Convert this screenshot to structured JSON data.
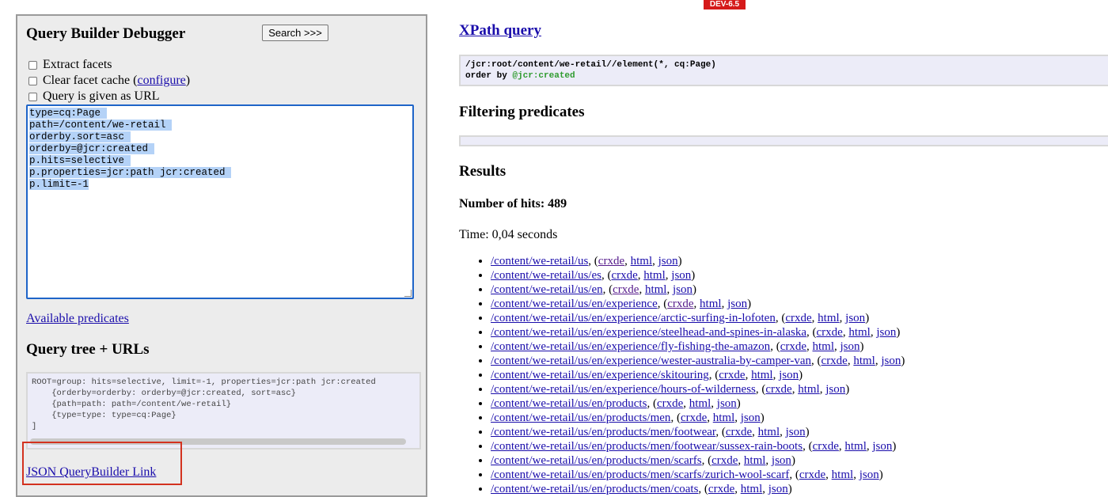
{
  "env_badge": "DEV-6.5",
  "left_panel": {
    "title": "Query Builder Debugger",
    "search_button": "Search >>>",
    "checkboxes": {
      "extract_facets": "Extract facets",
      "clear_cache": "Clear facet cache (",
      "configure_link": "configure",
      "clear_cache_close": ")",
      "query_as_url": "Query is given as URL"
    },
    "query_lines": [
      "type=cq:Page",
      "path=/content/we-retail",
      "orderby.sort=asc",
      "orderby=@jcr:created",
      "p.hits=selective",
      "p.properties=jcr:path jcr:created",
      "p.limit=-1"
    ],
    "available_predicates_link": "Available predicates",
    "tree_title": "Query tree + URLs",
    "tree_lines": [
      "ROOT=group: hits=selective, limit=-1, properties=jcr:path jcr:created",
      "    {orderby=orderby: orderby=@jcr:created, sort=asc}",
      "    {path=path: path=/content/we-retail}",
      "    {type=type: type=cq:Page}",
      "]"
    ],
    "json_link": "JSON QueryBuilder Link"
  },
  "right_panel": {
    "xpath_link": "XPath query",
    "xpath_line1": "/jcr:root/content/we-retail//element(*, cq:Page)",
    "xpath_line2_prefix": "order by ",
    "xpath_line2_attr": "@jcr:created",
    "filter_title": "Filtering predicates",
    "results_title": "Results",
    "hits_label": "Number of hits: 489",
    "time_label": "Time: 0,04 seconds",
    "link_crxde": "crxde",
    "link_html": "html",
    "link_json": "json",
    "results": [
      "/content/we-retail/us",
      "/content/we-retail/us/es",
      "/content/we-retail/us/en",
      "/content/we-retail/us/en/experience",
      "/content/we-retail/us/en/experience/arctic-surfing-in-lofoten",
      "/content/we-retail/us/en/experience/steelhead-and-spines-in-alaska",
      "/content/we-retail/us/en/experience/fly-fishing-the-amazon",
      "/content/we-retail/us/en/experience/wester-australia-by-camper-van",
      "/content/we-retail/us/en/experience/skitouring",
      "/content/we-retail/us/en/experience/hours-of-wilderness",
      "/content/we-retail/us/en/products",
      "/content/we-retail/us/en/products/men",
      "/content/we-retail/us/en/products/men/footwear",
      "/content/we-retail/us/en/products/men/footwear/sussex-rain-boots",
      "/content/we-retail/us/en/products/men/scarfs",
      "/content/we-retail/us/en/products/men/scarfs/zurich-wool-scarf",
      "/content/we-retail/us/en/products/men/coats"
    ]
  },
  "colors": {
    "badge": "#d51a1a",
    "highlight_box": "#d3321f",
    "textarea_border": "#1e64c8",
    "link": "#1a0dab",
    "visited_link": "#551a8b"
  }
}
